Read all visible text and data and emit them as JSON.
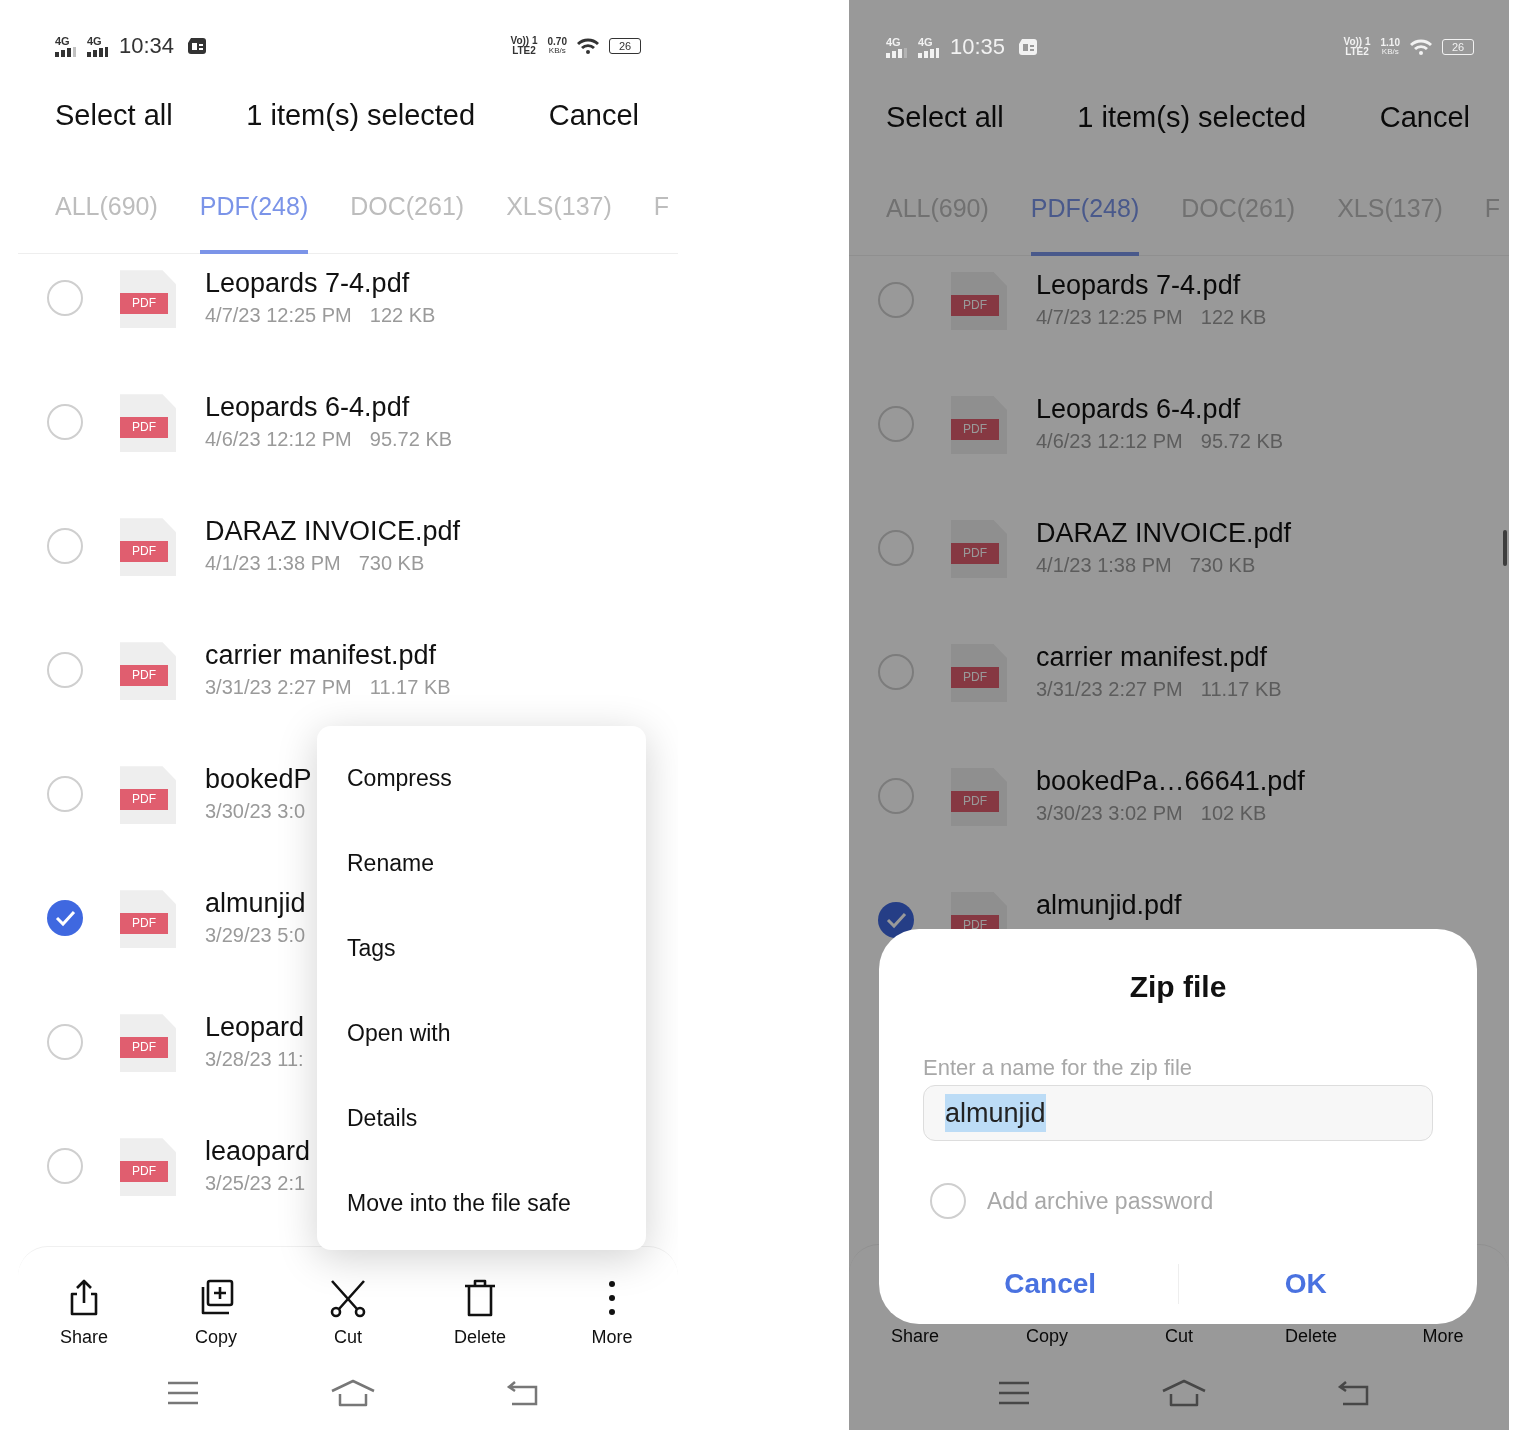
{
  "screens": [
    {
      "dimmed": false,
      "status_bar": {
        "network_1": "4G",
        "network_2": "4G",
        "time": "10:34",
        "volte": "Vo)) 1",
        "lte": "LTE2",
        "speed": "0.70",
        "speed_unit": "KB/s",
        "battery": "26"
      },
      "header": {
        "select_all": "Select all",
        "selection_count": "1 item(s) selected",
        "cancel": "Cancel"
      },
      "tabs": [
        {
          "label": "ALL(690)",
          "selected": false
        },
        {
          "label": "PDF(248)",
          "selected": true
        },
        {
          "label": "DOC(261)",
          "selected": false
        },
        {
          "label": "XLS(137)",
          "selected": false
        },
        {
          "label": "F",
          "selected": false
        }
      ],
      "files": [
        {
          "name": "Leopards 7-4.pdf",
          "type_label": "PDF",
          "date": "4/7/23 12:25 PM",
          "size": "122 KB",
          "checked": false
        },
        {
          "name": "Leopards 6-4.pdf",
          "type_label": "PDF",
          "date": "4/6/23 12:12 PM",
          "size": "95.72 KB",
          "checked": false
        },
        {
          "name": "DARAZ INVOICE.pdf",
          "type_label": "PDF",
          "date": "4/1/23 1:38 PM",
          "size": "730 KB",
          "checked": false
        },
        {
          "name": "carrier manifest.pdf",
          "type_label": "PDF",
          "date": "3/31/23 2:27 PM",
          "size": "11.17 KB",
          "checked": false
        },
        {
          "name": "bookedP",
          "type_label": "PDF",
          "date": "3/30/23 3:0",
          "checked": false
        },
        {
          "name": "almunjid",
          "type_label": "PDF",
          "date": "3/29/23 5:0",
          "checked": true
        },
        {
          "name": "Leopard",
          "type_label": "PDF",
          "date": "3/28/23 11:",
          "checked": false
        },
        {
          "name": "leaopard",
          "type_label": "PDF",
          "date": "3/25/23 2:1",
          "checked": false
        }
      ],
      "toolbar": [
        {
          "label": "Share",
          "kind": "share"
        },
        {
          "label": "Copy",
          "kind": "copy"
        },
        {
          "label": "Cut",
          "kind": "cut"
        },
        {
          "label": "Delete",
          "kind": "delete"
        },
        {
          "label": "More",
          "kind": "more"
        }
      ],
      "menu": {
        "items": [
          "Compress",
          "Rename",
          "Tags",
          "Open with",
          "Details",
          "Move into the file safe"
        ]
      }
    },
    {
      "dimmed": true,
      "status_bar": {
        "network_1": "4G",
        "network_2": "4G",
        "time": "10:35",
        "volte": "Vo)) 1",
        "lte": "LTE2",
        "speed": "1.10",
        "speed_unit": "KB/s",
        "battery": "26"
      },
      "header": {
        "select_all": "Select all",
        "selection_count": "1 item(s) selected",
        "cancel": "Cancel"
      },
      "tabs": [
        {
          "label": "ALL(690)",
          "selected": false
        },
        {
          "label": "PDF(248)",
          "selected": true
        },
        {
          "label": "DOC(261)",
          "selected": false
        },
        {
          "label": "XLS(137)",
          "selected": false
        },
        {
          "label": "F",
          "selected": false
        }
      ],
      "files": [
        {
          "name": "Leopards 7-4.pdf",
          "type_label": "PDF",
          "date": "4/7/23 12:25 PM",
          "size": "122 KB",
          "checked": false
        },
        {
          "name": "Leopards 6-4.pdf",
          "type_label": "PDF",
          "date": "4/6/23 12:12 PM",
          "size": "95.72 KB",
          "checked": false
        },
        {
          "name": "DARAZ INVOICE.pdf",
          "type_label": "PDF",
          "date": "4/1/23 1:38 PM",
          "size": "730 KB",
          "checked": false
        },
        {
          "name": "carrier manifest.pdf",
          "type_label": "PDF",
          "date": "3/31/23 2:27 PM",
          "size": "11.17 KB",
          "checked": false
        },
        {
          "name": "bookedPa…66641.pdf",
          "type_label": "PDF",
          "date": "3/30/23 3:02 PM",
          "size": "102 KB",
          "checked": false
        },
        {
          "name": "almunjid.pdf",
          "type_label": "PDF",
          "checked": true
        }
      ],
      "toolbar": [
        {
          "label": "Share"
        },
        {
          "label": "Copy"
        },
        {
          "label": "Cut"
        },
        {
          "label": "Delete"
        },
        {
          "label": "More"
        }
      ],
      "dialog": {
        "title": "Zip file",
        "field_label": "Enter a name for the zip file",
        "value": "almunjid",
        "value_selected": true,
        "password_option": "Add archive password",
        "password_checked": false,
        "cancel": "Cancel",
        "ok": "OK"
      }
    }
  ]
}
